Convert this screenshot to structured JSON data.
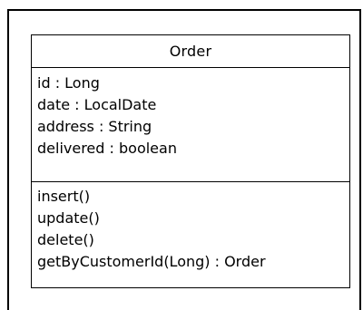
{
  "class": {
    "name": "Order",
    "attributes": [
      "id : Long",
      "date : LocalDate",
      "address : String",
      "delivered : boolean"
    ],
    "operations": [
      "insert()",
      "update()",
      "delete()",
      "getByCustomerId(Long) : Order"
    ]
  }
}
